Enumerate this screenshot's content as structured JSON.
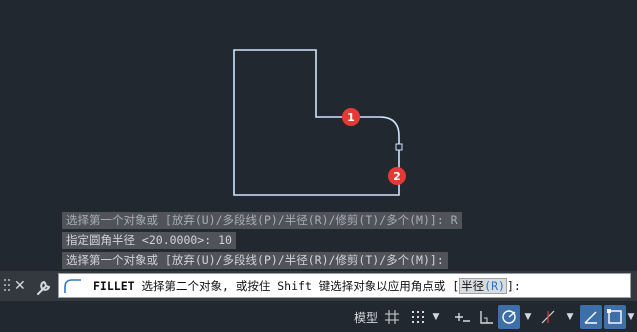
{
  "history": [
    "选择第一个对象或 [放弃(U)/多段线(P)/半径(R)/修剪(T)/多个(M)]: R",
    "指定圆角半径 <20.0000>: 10",
    "选择第一个对象或 [放弃(U)/多段线(P)/半径(R)/修剪(T)/多个(M)]:"
  ],
  "markers": [
    "1",
    "2"
  ],
  "command": {
    "name": "FILLET",
    "prompt_before_key": " 选择第二个对象, 或按住 ",
    "key": "Shift",
    "prompt_after_key": " 键选择对象以应用角点或 [",
    "option_label": "半径",
    "option_key": "(R)",
    "suffix": "]:"
  },
  "status": {
    "model_label": "模型"
  },
  "colors": {
    "shape": "#cfe3ff",
    "marker": "#e53935",
    "canvas": "#212830",
    "active": "#3f6fa8"
  }
}
